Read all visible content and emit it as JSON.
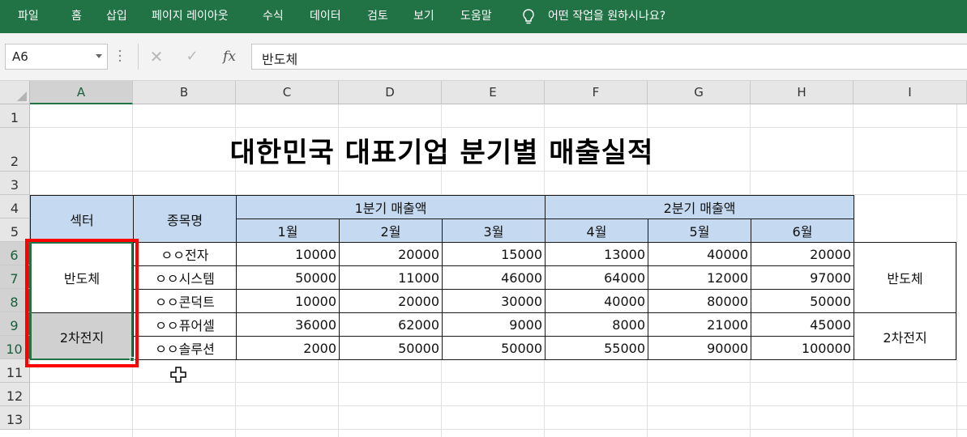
{
  "ribbon": {
    "tabs": [
      "파일",
      "홈",
      "삽입",
      "페이지 레이아웃",
      "수식",
      "데이터",
      "검토",
      "보기",
      "도움말"
    ],
    "tell_me": "어떤 작업을 원하시나요?",
    "bg_color": "#217346"
  },
  "formula_bar": {
    "name_box": "A6",
    "cancel_glyph": "✕",
    "enter_glyph": "✓",
    "fx_label": "fx",
    "formula": "반도체"
  },
  "sheet": {
    "columns": [
      "A",
      "B",
      "C",
      "D",
      "E",
      "F",
      "G",
      "H",
      "I"
    ],
    "rows": [
      "1",
      "2",
      "3",
      "4",
      "5",
      "6",
      "7",
      "8",
      "9",
      "10",
      "11",
      "12",
      "13"
    ],
    "title": "대한민국 대표기업 분기별 매출실적",
    "header": {
      "sector": "섹터",
      "stock_name": "종목명",
      "q1": "1분기 매출액",
      "q2": "2분기 매출액",
      "months": [
        "1월",
        "2월",
        "3월",
        "4월",
        "5월",
        "6월"
      ]
    },
    "sectors": [
      "반도체",
      "2차전지"
    ],
    "side_sectors": [
      "반도체",
      "2차전지"
    ],
    "companies": [
      {
        "name": "ㅇㅇ전자",
        "values": [
          "10000",
          "20000",
          "15000",
          "13000",
          "40000",
          "20000"
        ]
      },
      {
        "name": "ㅇㅇ시스템",
        "values": [
          "50000",
          "11000",
          "46000",
          "64000",
          "12000",
          "97000"
        ]
      },
      {
        "name": "ㅇㅇ콘덕트",
        "values": [
          "10000",
          "20000",
          "30000",
          "40000",
          "80000",
          "50000"
        ]
      },
      {
        "name": "ㅇㅇ퓨어셀",
        "values": [
          "36000",
          "62000",
          "9000",
          "8000",
          "21000",
          "45000"
        ]
      },
      {
        "name": "ㅇㅇ솔루션",
        "values": [
          "2000",
          "50000",
          "50000",
          "55000",
          "90000",
          "100000"
        ]
      }
    ],
    "header_fill": "#c5d9f1",
    "highlight_color": "#ff0000",
    "selected_fill": "#d0d0d0"
  }
}
